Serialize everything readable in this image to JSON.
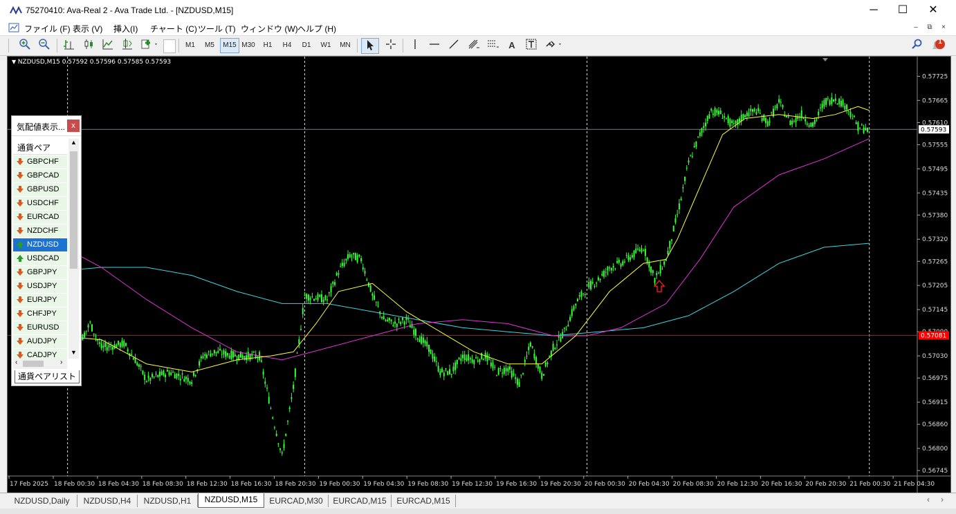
{
  "window": {
    "title": "75270410: Ava-Real 2 - Ava Trade Ltd. - [NZDUSD,M15]",
    "minimize": "─",
    "maximize": "☐",
    "close": "✕"
  },
  "menu": {
    "items": [
      "ファイル (F)",
      "表示 (V)",
      "挿入(I)",
      "チャート (C)",
      "ツール (T)",
      "ウィンドウ (W)",
      "ヘルプ (H)"
    ],
    "mdi_minimize": "–",
    "mdi_restore": "⧉",
    "mdi_close": "×"
  },
  "toolbar": {
    "timeframes": [
      "M1",
      "M5",
      "M15",
      "M30",
      "H1",
      "H4",
      "D1",
      "W1",
      "MN"
    ],
    "active_timeframe": "M15",
    "tools": [
      "zoom-in",
      "zoom-out",
      "bar-chart",
      "candlestick-chart",
      "line-chart",
      "autoscroll",
      "new-order",
      "cursor",
      "crosshair",
      "vertical-line",
      "horizontal-line",
      "trendline",
      "fibonacci",
      "fibonacci-fan",
      "text",
      "text-label",
      "arrows"
    ],
    "text_tool_label": "A",
    "notification_count": "1"
  },
  "chart": {
    "header": "NZDUSD,M15  0.57592 0.57596 0.57585 0.57593",
    "colors": {
      "background": "#000000",
      "candle": "#33ff33",
      "ma_fast": "#ffff33",
      "ma_mid": "#e034d8",
      "ma_slow": "#3ed6e0",
      "horizontal_line": "#ff0000",
      "arrow": "#ff2020"
    }
  },
  "chart_data": {
    "type": "line",
    "symbol": "NZDUSD",
    "timeframe": "M15",
    "ohlc_last": {
      "open": "0.57592",
      "high": "0.57596",
      "low": "0.57585",
      "close": "0.57593"
    },
    "y_ticks": [
      "0.57725",
      "0.57665",
      "0.57610",
      "0.57555",
      "0.57495",
      "0.57435",
      "0.57380",
      "0.57320",
      "0.57265",
      "0.57205",
      "0.57145",
      "0.57090",
      "0.57030",
      "0.56975",
      "0.56915",
      "0.56860",
      "0.56800",
      "0.56745"
    ],
    "x_ticks": [
      "17 Feb 2025",
      "18 Feb 00:30",
      "18 Feb 04:30",
      "18 Feb 08:30",
      "18 Feb 12:30",
      "18 Feb 16:30",
      "18 Feb 20:30",
      "19 Feb 00:30",
      "19 Feb 04:30",
      "19 Feb 08:30",
      "19 Feb 12:30",
      "19 Feb 16:30",
      "19 Feb 20:30",
      "20 Feb 00:30",
      "20 Feb 04:30",
      "20 Feb 08:30",
      "20 Feb 12:30",
      "20 Feb 16:30",
      "20 Feb 20:30",
      "21 Feb 00:30",
      "21 Feb 04:30"
    ],
    "ylim": [
      0.5674,
      0.5776
    ],
    "current_price": "0.57593",
    "hline_label": "0.57081",
    "hline_price": 0.57081,
    "close": [
      [
        0.5,
        0.5709
      ],
      [
        2,
        0.5706
      ],
      [
        3,
        0.5706
      ],
      [
        3.5,
        0.5711
      ],
      [
        4,
        0.5705
      ],
      [
        5,
        0.5706
      ],
      [
        5.5,
        0.5702
      ],
      [
        6,
        0.5697
      ],
      [
        7,
        0.5699
      ],
      [
        8,
        0.5697
      ],
      [
        8.5,
        0.5703
      ],
      [
        9,
        0.5704
      ],
      [
        10,
        0.5703
      ],
      [
        11,
        0.5703
      ],
      [
        11.5,
        0.569
      ],
      [
        12,
        0.5678
      ],
      [
        12.5,
        0.5695
      ],
      [
        13,
        0.5718
      ],
      [
        14,
        0.5717
      ],
      [
        14.5,
        0.5724
      ],
      [
        15,
        0.5728
      ],
      [
        15.5,
        0.5727
      ],
      [
        16,
        0.5718
      ],
      [
        16.5,
        0.5712
      ],
      [
        17,
        0.5711
      ],
      [
        17.5,
        0.5712
      ],
      [
        18,
        0.5708
      ],
      [
        18.5,
        0.5705
      ],
      [
        19,
        0.5699
      ],
      [
        19.5,
        0.5699
      ],
      [
        20,
        0.5703
      ],
      [
        20.5,
        0.5702
      ],
      [
        21,
        0.5703
      ],
      [
        21.5,
        0.5699
      ],
      [
        22,
        0.57
      ],
      [
        22.5,
        0.5696
      ],
      [
        23,
        0.5706
      ],
      [
        23.5,
        0.5698
      ],
      [
        24,
        0.5705
      ],
      [
        24.5,
        0.5709
      ],
      [
        25,
        0.5716
      ],
      [
        25.5,
        0.572
      ],
      [
        26,
        0.5722
      ],
      [
        26.5,
        0.5725
      ],
      [
        27,
        0.5726
      ],
      [
        27.5,
        0.5728
      ],
      [
        28,
        0.573
      ],
      [
        28.5,
        0.5722
      ],
      [
        29,
        0.5727
      ],
      [
        29.5,
        0.5738
      ],
      [
        30,
        0.5751
      ],
      [
        30.5,
        0.5758
      ],
      [
        31,
        0.5764
      ],
      [
        31.5,
        0.5763
      ],
      [
        32,
        0.576
      ],
      [
        32.5,
        0.5763
      ],
      [
        33,
        0.5764
      ],
      [
        33.5,
        0.5761
      ],
      [
        34,
        0.5766
      ],
      [
        34.5,
        0.5761
      ],
      [
        35,
        0.5763
      ],
      [
        35.5,
        0.576
      ],
      [
        36,
        0.5766
      ],
      [
        36.5,
        0.5767
      ],
      [
        37,
        0.5765
      ],
      [
        37.5,
        0.576
      ],
      [
        38,
        0.5759
      ]
    ],
    "ma_fast": [
      [
        0.5,
        0.571
      ],
      [
        2,
        0.5708
      ],
      [
        4,
        0.5707
      ],
      [
        6,
        0.5701
      ],
      [
        8,
        0.5699
      ],
      [
        10,
        0.5702
      ],
      [
        11.5,
        0.5703
      ],
      [
        12.5,
        0.5704
      ],
      [
        13.5,
        0.5711
      ],
      [
        14.5,
        0.5719
      ],
      [
        16,
        0.5721
      ],
      [
        17.5,
        0.5714
      ],
      [
        19,
        0.5709
      ],
      [
        20.5,
        0.5704
      ],
      [
        22,
        0.5701
      ],
      [
        23.5,
        0.5701
      ],
      [
        25,
        0.5708
      ],
      [
        26.5,
        0.5719
      ],
      [
        28,
        0.5726
      ],
      [
        29,
        0.5727
      ],
      [
        29.5,
        0.5732
      ],
      [
        30.5,
        0.5745
      ],
      [
        31.5,
        0.5758
      ],
      [
        32.5,
        0.5762
      ],
      [
        34,
        0.5763
      ],
      [
        35.5,
        0.5762
      ],
      [
        36.5,
        0.5763
      ],
      [
        37.5,
        0.5765
      ],
      [
        38,
        0.5764
      ]
    ],
    "ma_mid": [
      [
        0.5,
        0.5735
      ],
      [
        2,
        0.5731
      ],
      [
        4,
        0.5725
      ],
      [
        6,
        0.5717
      ],
      [
        8,
        0.571
      ],
      [
        10,
        0.5704
      ],
      [
        12,
        0.5702
      ],
      [
        14,
        0.5705
      ],
      [
        16,
        0.5708
      ],
      [
        18,
        0.5711
      ],
      [
        20,
        0.5712
      ],
      [
        22,
        0.5711
      ],
      [
        24,
        0.5708
      ],
      [
        25.5,
        0.5708
      ],
      [
        27,
        0.571
      ],
      [
        29,
        0.5716
      ],
      [
        30.5,
        0.5727
      ],
      [
        32,
        0.574
      ],
      [
        34,
        0.5748
      ],
      [
        36,
        0.5752
      ],
      [
        38,
        0.5757
      ]
    ],
    "ma_slow": [
      [
        0.5,
        0.5722
      ],
      [
        2,
        0.5724
      ],
      [
        4,
        0.5725
      ],
      [
        6,
        0.5725
      ],
      [
        8,
        0.5723
      ],
      [
        10,
        0.5719
      ],
      [
        12,
        0.5716
      ],
      [
        14,
        0.5716
      ],
      [
        16,
        0.5714
      ],
      [
        18,
        0.5712
      ],
      [
        20,
        0.571
      ],
      [
        22,
        0.5709
      ],
      [
        24,
        0.5708
      ],
      [
        26,
        0.5709
      ],
      [
        28,
        0.571
      ],
      [
        30,
        0.5713
      ],
      [
        32,
        0.5719
      ],
      [
        34,
        0.5726
      ],
      [
        36,
        0.573
      ],
      [
        38,
        0.5731
      ]
    ],
    "grid": false
  },
  "market_watch": {
    "title": "気配値表示...",
    "close": "x",
    "column_header": "通貨ペア",
    "rows": [
      {
        "symbol": "GBPCHF",
        "dir": "down"
      },
      {
        "symbol": "GBPCAD",
        "dir": "down"
      },
      {
        "symbol": "GBPUSD",
        "dir": "down"
      },
      {
        "symbol": "USDCHF",
        "dir": "down"
      },
      {
        "symbol": "EURCAD",
        "dir": "down"
      },
      {
        "symbol": "NZDCHF",
        "dir": "down"
      },
      {
        "symbol": "NZDUSD",
        "dir": "up",
        "selected": true
      },
      {
        "symbol": "USDCAD",
        "dir": "up"
      },
      {
        "symbol": "GBPJPY",
        "dir": "down"
      },
      {
        "symbol": "USDJPY",
        "dir": "down"
      },
      {
        "symbol": "EURJPY",
        "dir": "down"
      },
      {
        "symbol": "CHFJPY",
        "dir": "down"
      },
      {
        "symbol": "EURUSD",
        "dir": "down"
      },
      {
        "symbol": "AUDJPY",
        "dir": "down"
      },
      {
        "symbol": "CADJPY",
        "dir": "down"
      }
    ],
    "tab_label": "通貨ペアリスト",
    "scroll_left": "‹",
    "scroll_right": "›"
  },
  "tabs": {
    "items": [
      "NZDUSD,Daily",
      "NZDUSD,H4",
      "NZDUSD,H1",
      "NZDUSD,M15",
      "EURCAD,M30",
      "EURCAD,M15",
      "EURCAD,M15"
    ],
    "active": "NZDUSD,M15",
    "scroll_left": "‹",
    "scroll_right": "›"
  }
}
